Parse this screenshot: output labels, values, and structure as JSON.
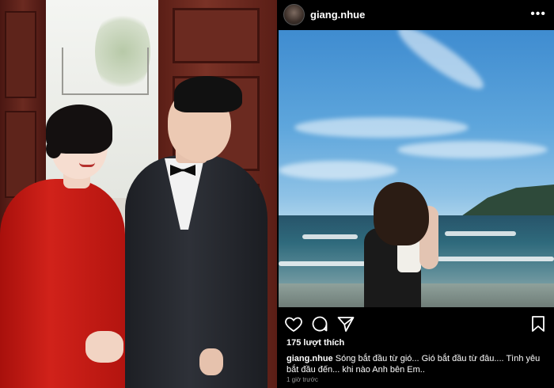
{
  "post": {
    "username": "giang.nhue",
    "more_label": "•••",
    "likes": "175 lượt thích",
    "caption_username": "giang.nhue",
    "caption_text": "Sóng bắt đầu từ gió... Gió bắt đầu từ đâu.... Tình yêu bắt đầu đến... khi nào Anh bên Em..",
    "timestamp": "1 giờ trước"
  },
  "icons": {
    "like": "heart-icon",
    "comment": "comment-icon",
    "share": "send-icon",
    "save": "bookmark-icon",
    "more": "more-icon"
  }
}
